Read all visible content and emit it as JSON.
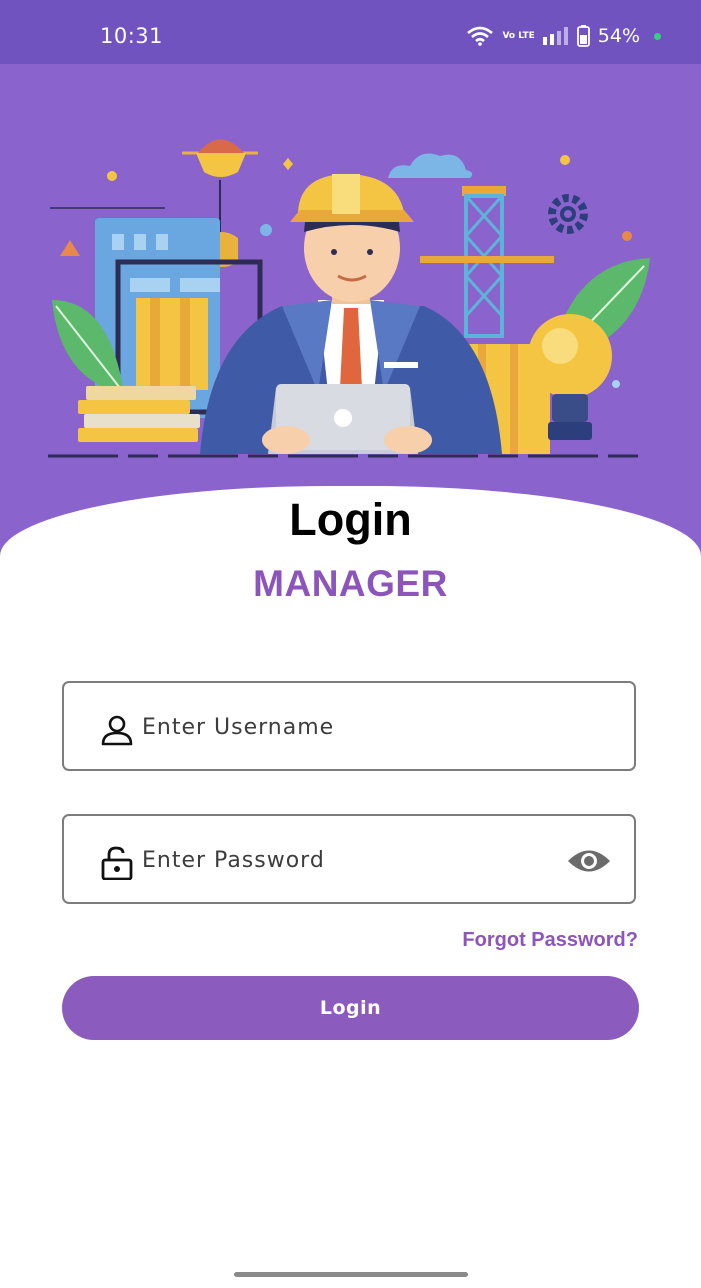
{
  "status_bar": {
    "time": "10:31",
    "network_label": "Vo LTE",
    "battery_percent": "54%",
    "icons": [
      "wifi-icon",
      "volte-icon",
      "signal-icon",
      "battery-icon"
    ]
  },
  "hero": {
    "illustration": "engineer-at-laptop-construction-illustration",
    "background_color": "#8b63cc"
  },
  "login": {
    "title": "Login",
    "role": "MANAGER",
    "username": {
      "placeholder": "Enter Username",
      "value": "",
      "icon": "user-icon"
    },
    "password": {
      "placeholder": "Enter Password",
      "value": "",
      "icon": "lock-icon",
      "toggle_icon": "eye-icon"
    },
    "forgot_link": "Forgot Password?",
    "submit_label": "Login"
  },
  "colors": {
    "accent": "#8c55bb",
    "button": "#8b5bbd",
    "status_bar": "#7153c0"
  }
}
